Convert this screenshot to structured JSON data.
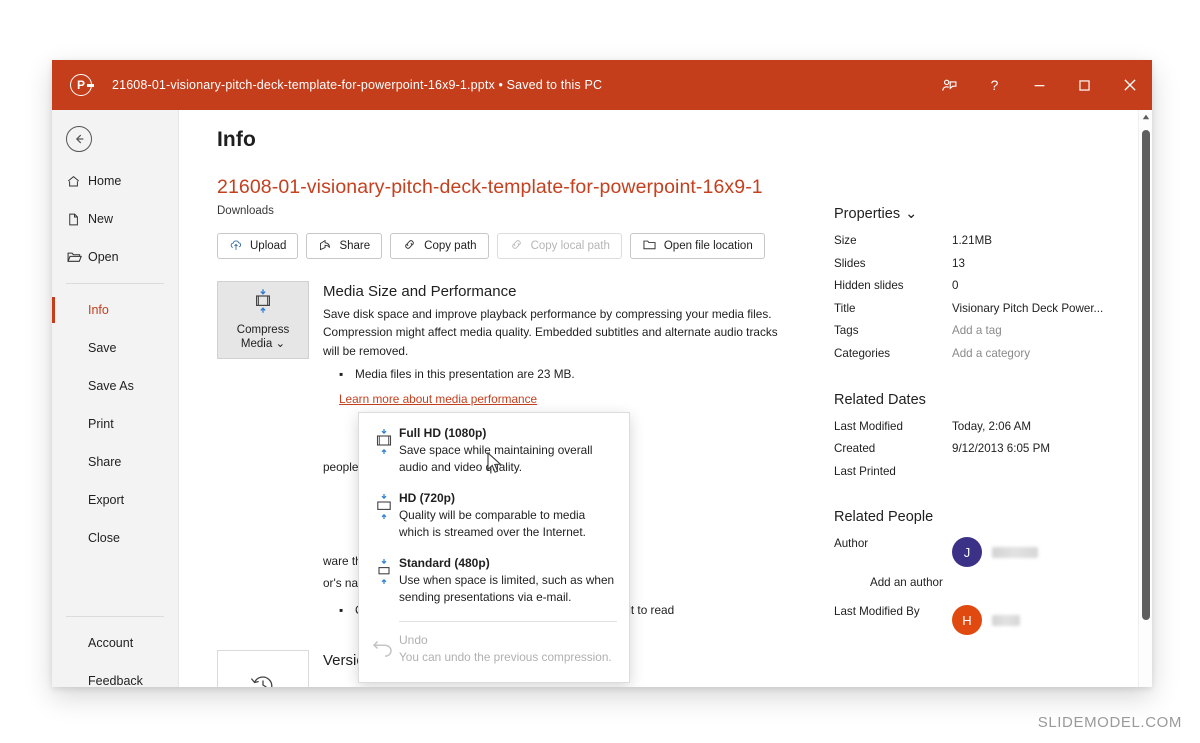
{
  "titlebar": {
    "logo": "powerpoint-logo",
    "document_title": "21608-01-visionary-pitch-deck-template-for-powerpoint-16x9-1.pptx • Saved to this PC",
    "accent_color": "#c43e1c",
    "buttons": [
      {
        "name": "comments-icon",
        "label": ""
      },
      {
        "name": "help-icon",
        "label": "?"
      },
      {
        "name": "minimize-button",
        "label": ""
      },
      {
        "name": "maximize-button",
        "label": ""
      },
      {
        "name": "close-button",
        "label": ""
      }
    ]
  },
  "sidebar": {
    "back_label": "",
    "top_items": [
      {
        "label": "Home",
        "icon": "home-icon"
      },
      {
        "label": "New",
        "icon": "new-document-icon"
      },
      {
        "label": "Open",
        "icon": "folder-open-icon"
      }
    ],
    "mid_items": [
      {
        "label": "Info",
        "active": true
      },
      {
        "label": "Save",
        "active": false
      },
      {
        "label": "Save As",
        "active": false
      },
      {
        "label": "Print",
        "active": false
      },
      {
        "label": "Share",
        "active": false
      },
      {
        "label": "Export",
        "active": false
      },
      {
        "label": "Close",
        "active": false
      }
    ],
    "bottom_items": [
      {
        "label": "Account"
      },
      {
        "label": "Feedback"
      }
    ],
    "active_color": "#c43e1c"
  },
  "main": {
    "page_title": "Info",
    "file_name": "21608-01-visionary-pitch-deck-template-for-powerpoint-16x9-1",
    "file_location": "Downloads",
    "file_name_color": "#c4401f",
    "actions": [
      {
        "label": "Upload",
        "icon": "cloud-upload-icon",
        "disabled": false
      },
      {
        "label": "Share",
        "icon": "share-icon",
        "disabled": false
      },
      {
        "label": "Copy path",
        "icon": "link-icon",
        "disabled": false
      },
      {
        "label": "Copy local path",
        "icon": "link-icon",
        "disabled": true
      },
      {
        "label": "Open file location",
        "icon": "folder-icon",
        "disabled": false
      }
    ],
    "media_section": {
      "button_label_line1": "Compress",
      "button_label_line2": "Media",
      "button_icon": "compress-media-icon",
      "title": "Media Size and Performance",
      "text": "Save disk space and improve playback performance by compressing your media files. Compression might affect media quality. Embedded subtitles and alternate audio tracks will be removed.",
      "bullet": "Media files in this presentation are 23 MB.",
      "link": "Learn more about media performance"
    },
    "protect_section": {
      "text_visible": "people can make to this presentation."
    },
    "inspect_section": {
      "line1": "ware that it contains:",
      "line2": "or's name and cropped out image data",
      "bullet": "Content that people with disabilities might find difficult to read"
    },
    "version_section": {
      "title": "Version History",
      "icon": "history-clock-icon"
    }
  },
  "dropdown": {
    "items": [
      {
        "title": "Full HD (1080p)",
        "desc": "Save space while maintaining overall audio and video quality.",
        "icon": "compress-fullhd-icon",
        "disabled": false
      },
      {
        "title": "HD (720p)",
        "desc": "Quality will be comparable to media which is streamed over the Internet.",
        "icon": "compress-hd-icon",
        "disabled": false
      },
      {
        "title": "Standard (480p)",
        "desc": "Use when space is limited, such as when sending presentations via e-mail.",
        "icon": "compress-standard-icon",
        "disabled": false
      },
      {
        "title": "Undo",
        "desc": "You can undo the previous compression.",
        "icon": "undo-icon",
        "disabled": true
      }
    ]
  },
  "rail": {
    "properties_title": "Properties",
    "properties": [
      {
        "key": "Size",
        "value": "1.21MB",
        "placeholder": false
      },
      {
        "key": "Slides",
        "value": "13",
        "placeholder": false
      },
      {
        "key": "Hidden slides",
        "value": "0",
        "placeholder": false
      },
      {
        "key": "Title",
        "value": "Visionary Pitch Deck Power...",
        "placeholder": false
      },
      {
        "key": "Tags",
        "value": "Add a tag",
        "placeholder": true
      },
      {
        "key": "Categories",
        "value": "Add a category",
        "placeholder": true
      }
    ],
    "dates_title": "Related Dates",
    "dates": [
      {
        "key": "Last Modified",
        "value": "Today, 2:06 AM"
      },
      {
        "key": "Created",
        "value": "9/12/2013 6:05 PM"
      },
      {
        "key": "Last Printed",
        "value": ""
      }
    ],
    "people_title": "Related People",
    "author_key": "Author",
    "author_initial": "J",
    "author_color": "#3b3287",
    "add_author_label": "Add an author",
    "modified_key": "Last Modified By",
    "modified_initial": "H",
    "modified_color": "#e0490f"
  },
  "watermark": "SLIDEMODEL.COM"
}
